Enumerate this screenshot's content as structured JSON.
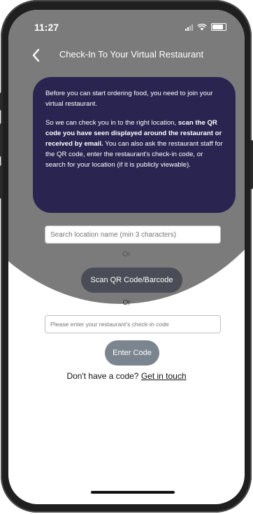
{
  "status_bar": {
    "time": "11:27"
  },
  "nav": {
    "title": "Check-In To Your Virtual Restaurant",
    "back_icon": "chevron-left-icon"
  },
  "info_card": {
    "paragraph1": "Before you can start ordering food, you need to join your virtual restaurant.",
    "paragraph2_part1": "So we can check you in to the right location,",
    "paragraph2_bold": "scan the QR code you have seen displayed around the restaurant or received by email.",
    "paragraph2_part2": "You can also ask the restaurant staff for the QR code, enter the restaurant's check-in code, or search for your location (if it is publicly viewable)."
  },
  "search": {
    "placeholder": "Search location name (min 3 characters)",
    "value": ""
  },
  "or_label_1": "Or",
  "scan_button_label": "Scan QR Code/Barcode",
  "or_label_2": "Or",
  "code_input": {
    "placeholder": "Please enter your restaurant's check-in code",
    "value": ""
  },
  "enter_button_label": "Enter Code",
  "footer": {
    "text": "Don't have a code?",
    "link": "Get in touch"
  },
  "colors": {
    "card_background": "#2a2550",
    "header_background": "#7b7b7b",
    "scan_button": "#4a4d57",
    "enter_button": "#7b8590"
  }
}
